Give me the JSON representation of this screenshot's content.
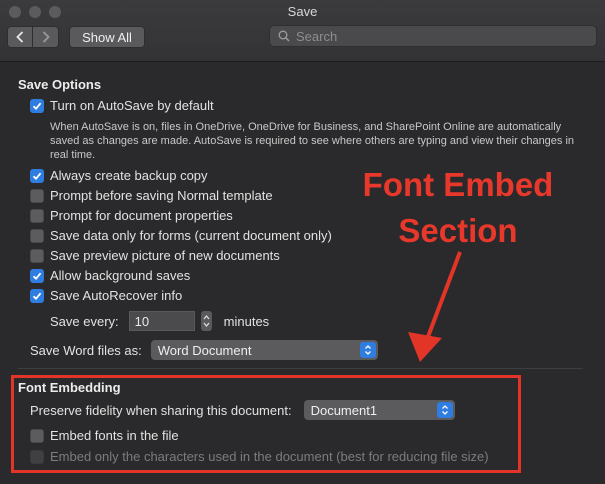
{
  "window": {
    "title": "Save"
  },
  "toolbar": {
    "show_all_label": "Show All",
    "search_placeholder": "Search"
  },
  "save_options": {
    "heading": "Save Options",
    "autosave": {
      "label": "Turn on AutoSave by default",
      "checked": true
    },
    "autosave_description": "When AutoSave is on, files in OneDrive, OneDrive for Business, and SharePoint Online are automatically saved as changes are made. AutoSave is required to see where others are typing and view their changes in real time.",
    "options": [
      {
        "label": "Always create backup copy",
        "checked": true
      },
      {
        "label": "Prompt before saving Normal template",
        "checked": false
      },
      {
        "label": "Prompt for document properties",
        "checked": false
      },
      {
        "label": "Save data only for forms (current document only)",
        "checked": false
      },
      {
        "label": "Save preview picture of new documents",
        "checked": false
      },
      {
        "label": "Allow background saves",
        "checked": true
      },
      {
        "label": "Save AutoRecover info",
        "checked": true
      }
    ],
    "save_every": {
      "label": "Save every:",
      "value": "10",
      "unit": "minutes"
    },
    "save_as": {
      "label": "Save Word files as:",
      "value": "Word Document"
    }
  },
  "font_embedding": {
    "heading": "Font Embedding",
    "preserve": {
      "label": "Preserve fidelity when sharing this document:",
      "value": "Document1"
    },
    "embed_fonts": {
      "label": "Embed fonts in the file",
      "checked": false
    },
    "embed_chars": {
      "label": "Embed only the characters used in the document (best for reducing file size)",
      "checked": false,
      "disabled": true
    }
  },
  "annotation": {
    "line1": "Font Embed",
    "line2": "Section",
    "color": "#e23427"
  },
  "colors": {
    "accent": "#2f7de1"
  }
}
